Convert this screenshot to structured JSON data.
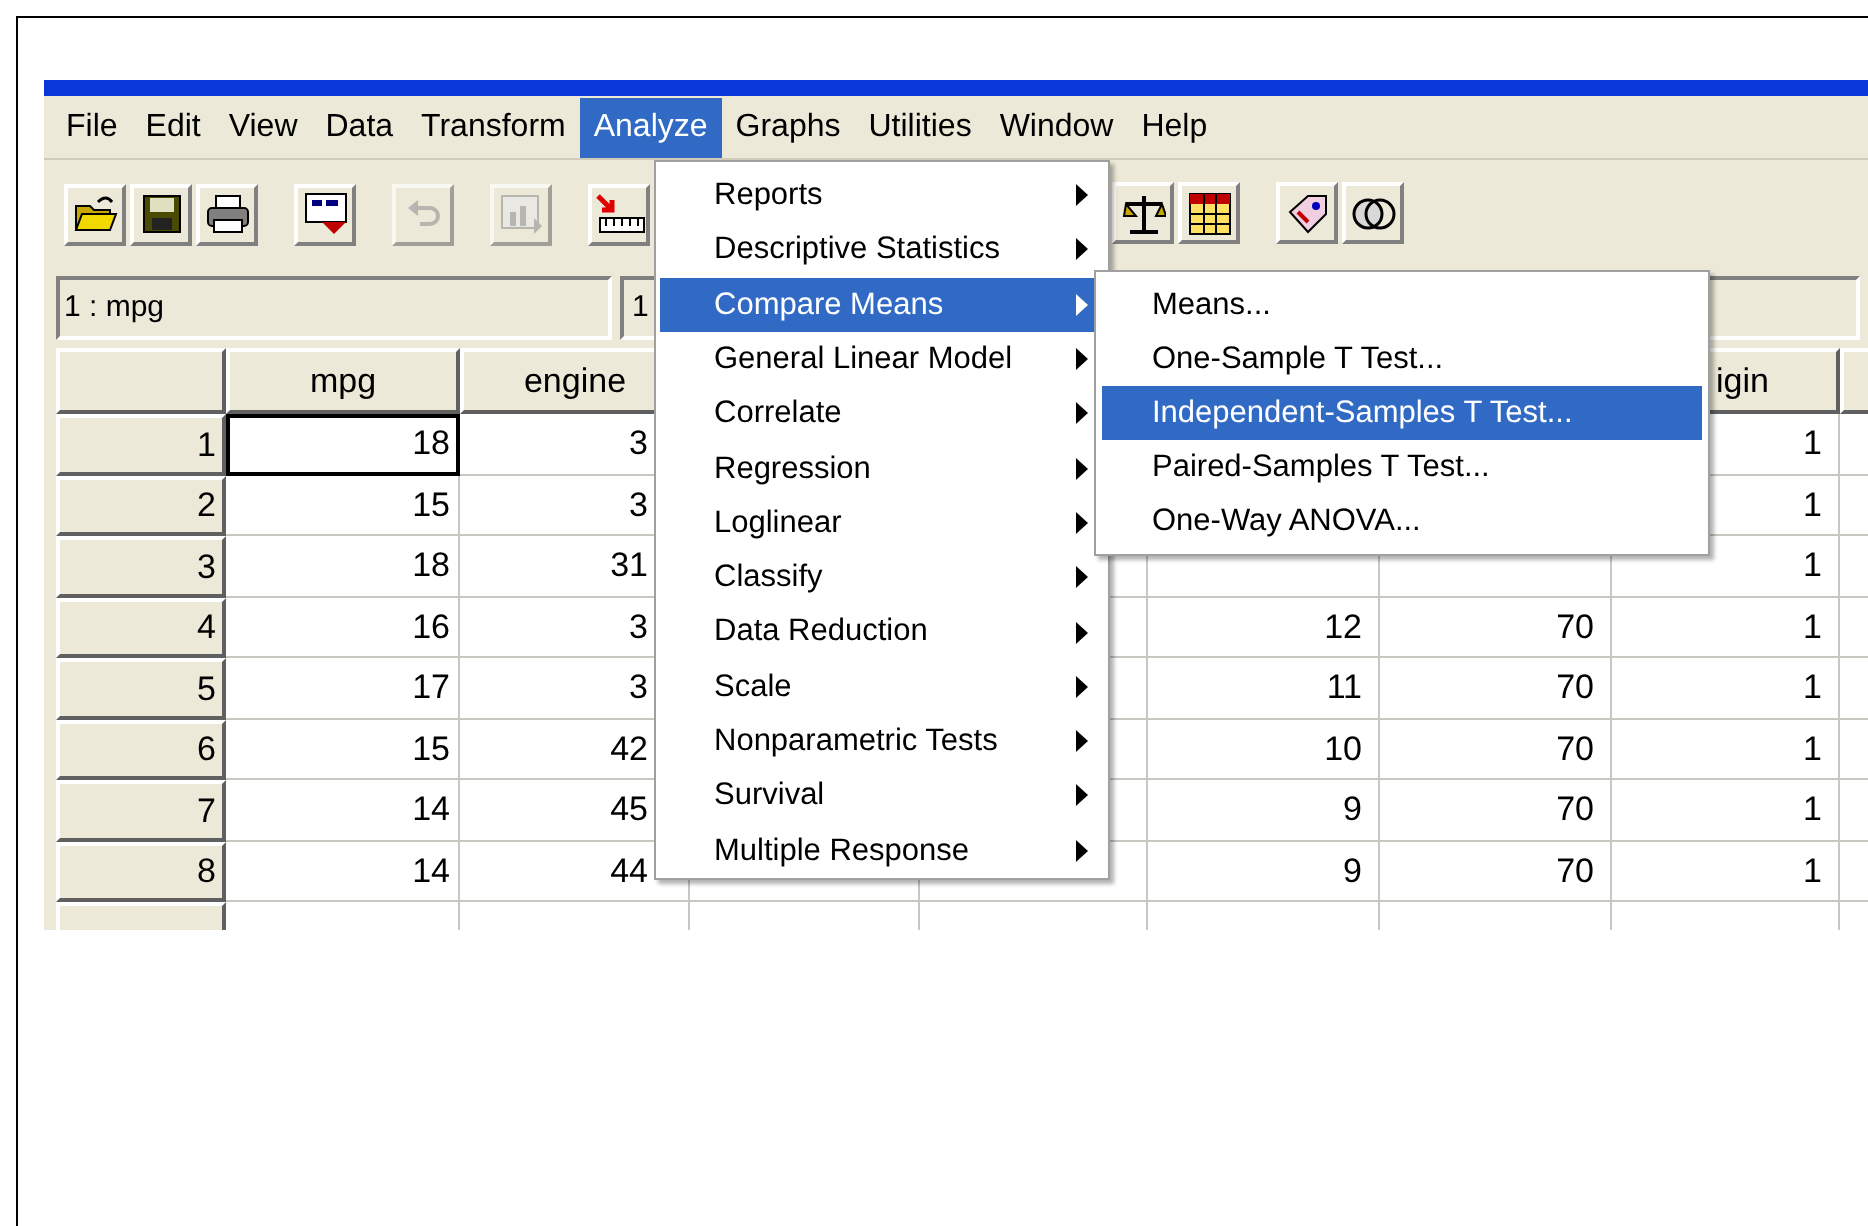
{
  "menubar": [
    {
      "label": "File",
      "selected": false
    },
    {
      "label": "Edit",
      "selected": false
    },
    {
      "label": "View",
      "selected": false
    },
    {
      "label": "Data",
      "selected": false
    },
    {
      "label": "Transform",
      "selected": false
    },
    {
      "label": "Analyze",
      "selected": true
    },
    {
      "label": "Graphs",
      "selected": false
    },
    {
      "label": "Utilities",
      "selected": false
    },
    {
      "label": "Window",
      "selected": false
    },
    {
      "label": "Help",
      "selected": false
    }
  ],
  "toolbar_left": [
    [
      {
        "kind": "open",
        "disabled": false
      },
      {
        "kind": "save",
        "disabled": false
      },
      {
        "kind": "print",
        "disabled": false
      }
    ],
    [
      {
        "kind": "dialog",
        "disabled": false
      }
    ],
    [
      {
        "kind": "undo",
        "disabled": true
      }
    ],
    [
      {
        "kind": "chart",
        "disabled": true
      }
    ],
    [
      {
        "kind": "goto",
        "disabled": false
      }
    ]
  ],
  "toolbar_right": [
    [
      {
        "kind": "scale",
        "disabled": false
      },
      {
        "kind": "grid",
        "disabled": false
      }
    ],
    [
      {
        "kind": "tag",
        "disabled": false
      },
      {
        "kind": "circles",
        "disabled": false
      }
    ]
  ],
  "cell_editor": {
    "cell_ref": "1 : mpg",
    "value": "1"
  },
  "table": {
    "headers": {
      "mpg": "mpg",
      "engine": "engine",
      "origin": "igin"
    },
    "rows": [
      {
        "number": "1",
        "selected": true,
        "mpg": "18",
        "engine": "3",
        "origin": "1"
      },
      {
        "number": "2",
        "selected": false,
        "mpg": "15",
        "engine": "3",
        "origin": "1"
      },
      {
        "number": "3",
        "selected": false,
        "mpg": "18",
        "engine": "31",
        "origin": "1"
      },
      {
        "number": "4",
        "selected": false,
        "mpg": "16",
        "engine": "3",
        "column_6": "12",
        "column_7": "70",
        "origin": "1"
      },
      {
        "number": "5",
        "selected": false,
        "mpg": "17",
        "engine": "3",
        "column_6": "11",
        "column_7": "70",
        "origin": "1"
      },
      {
        "number": "6",
        "selected": false,
        "mpg": "15",
        "engine": "42",
        "column_6": "10",
        "column_7": "70",
        "origin": "1"
      },
      {
        "number": "7",
        "selected": false,
        "mpg": "14",
        "engine": "45",
        "column_6": "9",
        "column_7": "70",
        "origin": "1"
      },
      {
        "number": "8",
        "selected": false,
        "mpg": "14",
        "engine": "44",
        "column_6": "9",
        "column_7": "70",
        "origin": "1"
      }
    ]
  },
  "analyze_menu": [
    {
      "label": "Reports",
      "selected": false,
      "submenu": true
    },
    {
      "label": "Descriptive Statistics",
      "selected": false,
      "submenu": true
    },
    {
      "label": "Compare Means",
      "selected": true,
      "submenu": true
    },
    {
      "label": "General Linear Model",
      "selected": false,
      "submenu": true
    },
    {
      "label": "Correlate",
      "selected": false,
      "submenu": true
    },
    {
      "label": "Regression",
      "selected": false,
      "submenu": true
    },
    {
      "label": "Loglinear",
      "selected": false,
      "submenu": true
    },
    {
      "label": "Classify",
      "selected": false,
      "submenu": true
    },
    {
      "label": "Data Reduction",
      "selected": false,
      "submenu": true
    },
    {
      "label": "Scale",
      "selected": false,
      "submenu": true
    },
    {
      "label": "Nonparametric Tests",
      "selected": false,
      "submenu": true
    },
    {
      "label": "Survival",
      "selected": false,
      "submenu": true
    },
    {
      "label": "Multiple Response",
      "selected": false,
      "submenu": true
    }
  ],
  "compare_means_menu": [
    {
      "label": "Means...",
      "selected": false
    },
    {
      "label": "One-Sample T Test...",
      "selected": false
    },
    {
      "label": "Independent-Samples T Test...",
      "selected": true
    },
    {
      "label": "Paired-Samples T Test...",
      "selected": false
    },
    {
      "label": "One-Way ANOVA...",
      "selected": false
    }
  ]
}
